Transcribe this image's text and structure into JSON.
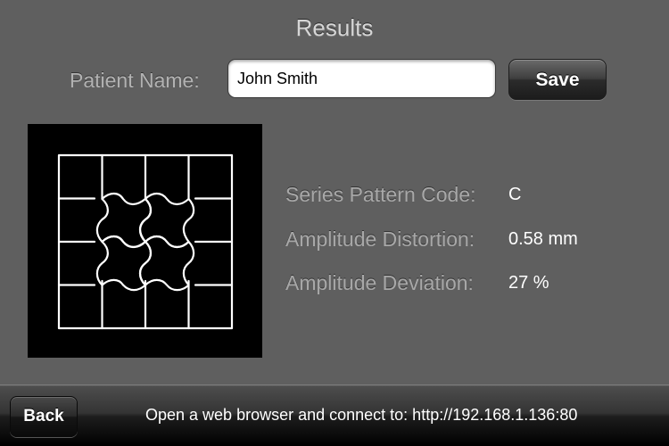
{
  "header": {
    "title": "Results"
  },
  "patient": {
    "label": "Patient Name:",
    "name_value": "John Smith",
    "save_label": "Save"
  },
  "results": {
    "series_pattern_code_label": "Series Pattern Code:",
    "series_pattern_code_value": "C",
    "amplitude_distortion_label": "Amplitude Distortion:",
    "amplitude_distortion_value": "0.58 mm",
    "amplitude_deviation_label": "Amplitude Deviation:",
    "amplitude_deviation_value": "27 %"
  },
  "grid_image": {
    "icon": "amsler-grid-distortion-pattern",
    "background_color": "#000000",
    "line_color": "#ffffff"
  },
  "footer": {
    "back_label": "Back",
    "connect_text": "Open a web browser and connect to: http://192.168.1.136:80"
  },
  "colors": {
    "background": "#5f5f5f",
    "button_text": "#ffffff"
  }
}
